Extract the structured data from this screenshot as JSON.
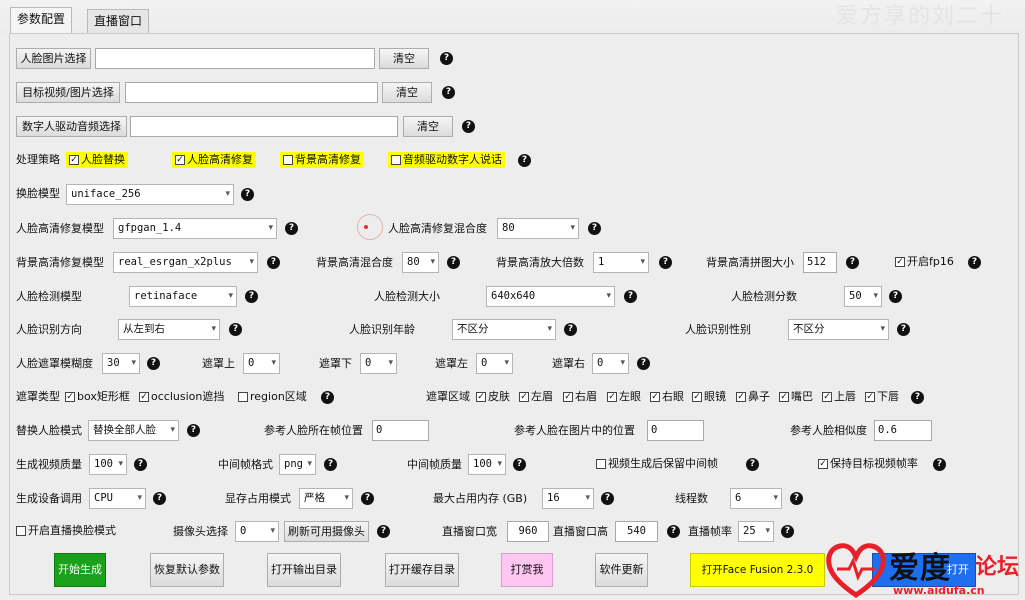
{
  "tabs": [
    "参数配置",
    "直播窗口"
  ],
  "header_watermark": "爱方享的刘二十",
  "face_image": {
    "button": "人脸图片选择",
    "value": "",
    "clear": "清空"
  },
  "target_video": {
    "button": "目标视频/图片选择",
    "value": "",
    "clear": "清空"
  },
  "audio": {
    "button": "数字人驱动音频选择",
    "value": "",
    "clear": "清空"
  },
  "strategy": {
    "label": "处理策略",
    "options": [
      {
        "label": "人脸替换",
        "checked": true
      },
      {
        "label": "人脸高清修复",
        "checked": true
      },
      {
        "label": "背景高清修复",
        "checked": false
      },
      {
        "label": "音频驱动数字人说话",
        "checked": false
      }
    ]
  },
  "swap_model": {
    "label": "换脸模型",
    "value": "uniface_256"
  },
  "enhance": {
    "model_label": "人脸高清修复模型",
    "model_value": "gfpgan_1.4",
    "blend_label": "人脸高清修复混合度",
    "blend_value": "80"
  },
  "background": {
    "model_label": "背景高清修复模型",
    "model_value": "real_esrgan_x2plus",
    "blend_label": "背景高清混合度",
    "blend_value": "80",
    "scale_label": "背景高清放大倍数",
    "scale_value": "1",
    "tile_label": "背景高清拼图大小",
    "tile_value": "512",
    "fp16_label": "开启fp16",
    "fp16_checked": true
  },
  "detect": {
    "model_label": "人脸检测模型",
    "model_value": "retinaface",
    "size_label": "人脸检测大小",
    "size_value": "640x640",
    "score_label": "人脸检测分数",
    "score_value": "50"
  },
  "recognize": {
    "dir_label": "人脸识别方向",
    "dir_value": "从左到右",
    "age_label": "人脸识别年龄",
    "age_value": "不区分",
    "gender_label": "人脸识别性别",
    "gender_value": "不区分"
  },
  "mask": {
    "blur_label": "人脸遮罩模糊度",
    "blur_value": "30",
    "top_label": "遮罩上",
    "top_value": "0",
    "bottom_label": "遮罩下",
    "bottom_value": "0",
    "left_label": "遮罩左",
    "left_value": "0",
    "right_label": "遮罩右",
    "right_value": "0"
  },
  "mask_type": {
    "label": "遮罩类型",
    "options": [
      {
        "label": "box矩形框",
        "checked": true
      },
      {
        "label": "occlusion遮挡",
        "checked": true
      },
      {
        "label": "region区域",
        "checked": false
      }
    ]
  },
  "mask_region": {
    "label": "遮罩区域",
    "options": [
      {
        "label": "皮肤",
        "checked": true
      },
      {
        "label": "左眉",
        "checked": true
      },
      {
        "label": "右眉",
        "checked": true
      },
      {
        "label": "左眼",
        "checked": true
      },
      {
        "label": "右眼",
        "checked": true
      },
      {
        "label": "眼镜",
        "checked": true
      },
      {
        "label": "鼻子",
        "checked": true
      },
      {
        "label": "嘴巴",
        "checked": true
      },
      {
        "label": "上唇",
        "checked": true
      },
      {
        "label": "下唇",
        "checked": true
      }
    ]
  },
  "replace": {
    "mode_label": "替换人脸模式",
    "mode_value": "替换全部人脸",
    "frame_label": "参考人脸所在帧位置",
    "frame_value": "0",
    "pos_label": "参考人脸在图片中的位置",
    "pos_value": "0",
    "sim_label": "参考人脸相似度",
    "sim_value": "0.6"
  },
  "output": {
    "quality_label": "生成视频质量",
    "quality_value": "100",
    "frame_fmt_label": "中间帧格式",
    "frame_fmt_value": "png",
    "frame_q_label": "中间帧质量",
    "frame_q_value": "100",
    "keep_frames_label": "视频生成后保留中间帧",
    "keep_frames_checked": false,
    "keep_fps_label": "保持目标视频帧率",
    "keep_fps_checked": true
  },
  "device": {
    "label": "生成设备调用",
    "value": "CPU",
    "vram_label": "显存占用模式",
    "vram_value": "严格",
    "mem_label": "最大占用内存 (GB)",
    "mem_value": "16",
    "threads_label": "线程数",
    "threads_value": "6"
  },
  "live": {
    "enable_label": "开启直播换脸模式",
    "enable_checked": false,
    "camera_label": "摄像头选择",
    "camera_value": "0",
    "refresh_label": "刷新可用摄像头",
    "width_label": "直播窗口宽",
    "width_value": "960",
    "height_label": "直播窗口高",
    "height_value": "540",
    "fps_label": "直播帧率",
    "fps_value": "25"
  },
  "actions": {
    "start": "开始生成",
    "reset": "恢复默认参数",
    "open_output": "打开输出目录",
    "open_cache": "打开缓存目录",
    "donate": "打赏我",
    "update": "软件更新",
    "open_ff": "打开Face Fusion 2.3.0",
    "extra": "打开"
  },
  "colors": {
    "green": "#1aa01a",
    "pink": "#ffc6f2",
    "yellow": "#ffff00",
    "blue": "#1e6ef0",
    "red": "#e8202a"
  },
  "logo": {
    "main": "爱度",
    "forum": "论坛",
    "url": "www.aidufa.cn"
  }
}
